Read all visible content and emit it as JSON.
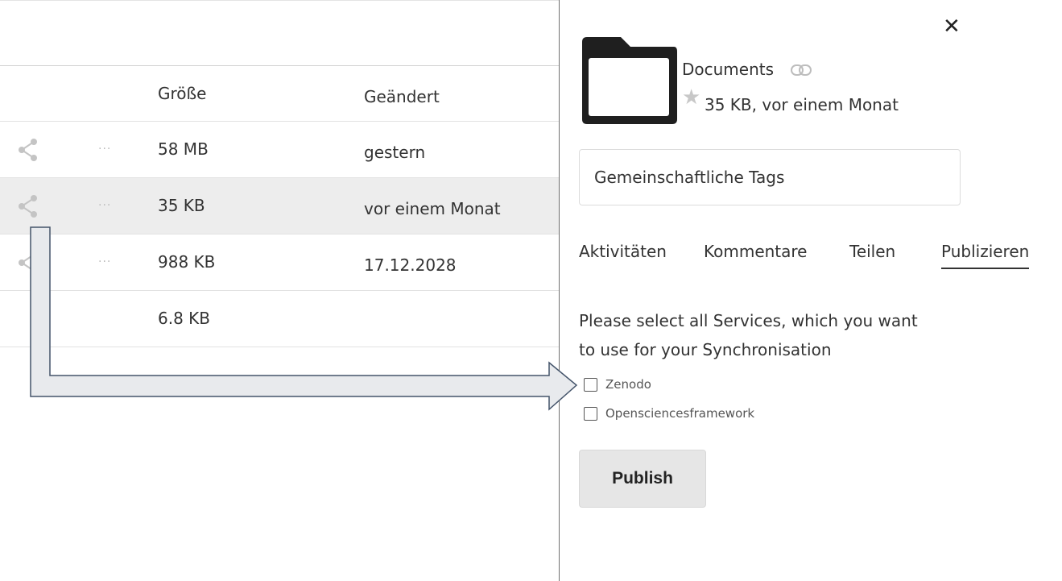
{
  "file_list": {
    "headers": {
      "size": "Größe",
      "modified": "Geändert"
    },
    "rows": [
      {
        "size": "58 MB",
        "modified": "gestern",
        "selected": false
      },
      {
        "size": "35 KB",
        "modified": "vor einem Monat",
        "selected": true
      },
      {
        "size": "988 KB",
        "modified": "17.12.2028",
        "selected": false
      },
      {
        "size": "6.8 KB",
        "modified": "",
        "selected": false
      }
    ],
    "more_glyph": "···",
    "share_icon": "share-icon",
    "more_icon": "more-icon"
  },
  "sidebar": {
    "close_glyph": "✕",
    "folder_icon": "folder-icon",
    "file_name": "Documents",
    "link_icon": "link-icon",
    "star_glyph": "★",
    "file_meta": "35 KB, vor einem Monat",
    "tags_placeholder": "Gemeinschaftliche Tags",
    "tabs": [
      {
        "label": "Aktivitäten",
        "active": false
      },
      {
        "label": "Kommentare",
        "active": false
      },
      {
        "label": "Teilen",
        "active": false
      },
      {
        "label": "Publizieren",
        "active": true
      }
    ],
    "publish": {
      "description_line1": "Please select all Services, which you want",
      "description_line2": "to use for your Synchronisation",
      "services": [
        {
          "label": "Zenodo",
          "checked": false
        },
        {
          "label": "Opensciencesframework",
          "checked": false
        }
      ],
      "button_label": "Publish"
    }
  },
  "colors": {
    "selected_row": "#ededed",
    "divider": "#e2e2e2",
    "arrow_fill": "#e8eaed",
    "arrow_stroke": "#44546a",
    "folder": "#1f1f1f"
  }
}
